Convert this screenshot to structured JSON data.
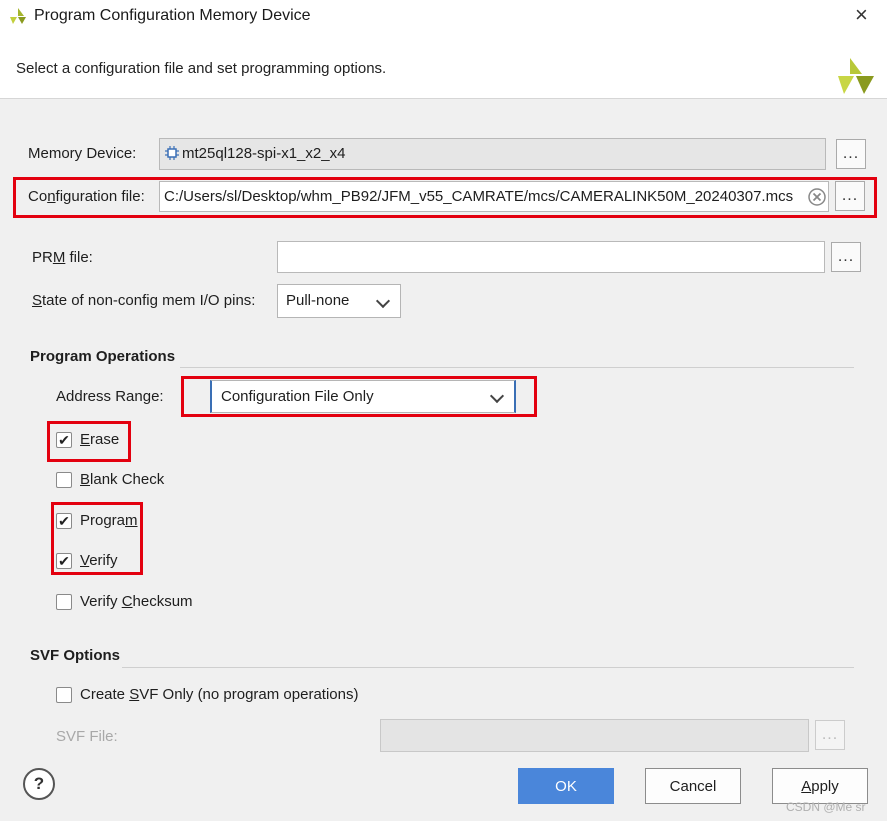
{
  "window": {
    "title": "Program Configuration Memory Device",
    "close_icon": "×"
  },
  "header": {
    "subtitle": "Select a configuration file and set programming options."
  },
  "memory_device": {
    "label": "Memory Device:",
    "value": "mt25ql128-spi-x1_x2_x4",
    "browse": "..."
  },
  "config_file": {
    "label_pre": "Co",
    "label_ul": "n",
    "label_post": "figuration file:",
    "value": "C:/Users/sl/Desktop/whm_PB92/JFM_v55_CAMRATE/mcs/CAMERALINK50M_20240307.mcs",
    "browse": "..."
  },
  "prm_file": {
    "label_pre": "PR",
    "label_ul": "M",
    "label_post": " file:",
    "value": "",
    "browse": "..."
  },
  "state_pins": {
    "label_pre": "",
    "label_ul": "S",
    "label_post": "tate of non-config mem I/O pins:",
    "value": "Pull-none"
  },
  "program_ops": {
    "heading": "Program Operations",
    "address_range": {
      "label_pre": "Address Ran",
      "label_ul": "g",
      "label_post": "e:",
      "value": "Configuration File Only"
    },
    "erase": {
      "ul": "E",
      "rest": "rase",
      "checked": true
    },
    "blank_check": {
      "ul": "B",
      "rest": "lank Check",
      "checked": false
    },
    "program": {
      "pre": "Progra",
      "ul": "m",
      "rest": "",
      "checked": true
    },
    "verify": {
      "ul": "V",
      "rest": "erify",
      "checked": true
    },
    "verify_checksum": {
      "pre": "Verify ",
      "ul": "C",
      "rest": "hecksum",
      "checked": false
    }
  },
  "svf_options": {
    "heading": "SVF Options",
    "create_svf": {
      "pre": "Create ",
      "ul": "S",
      "rest": "VF Only (no program operations)",
      "checked": false
    },
    "svf_file_label": "SVF File:",
    "browse": "..."
  },
  "buttons": {
    "help": "?",
    "ok": "OK",
    "cancel": "Cancel",
    "apply_ul": "A",
    "apply_rest": "pply"
  },
  "watermark": "CSDN @Me sr",
  "colors": {
    "highlight": "#e3000f",
    "primary": "#4a86da",
    "logo": "#a4b52c"
  }
}
